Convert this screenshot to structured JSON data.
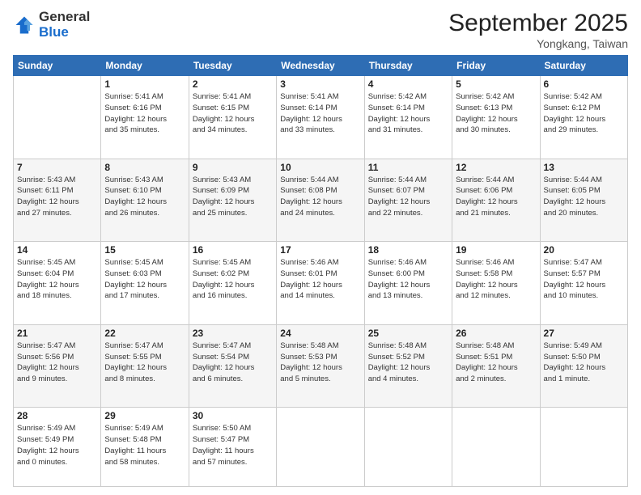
{
  "logo": {
    "line1": "General",
    "line2": "Blue"
  },
  "header": {
    "month": "September 2025",
    "location": "Yongkang, Taiwan"
  },
  "weekdays": [
    "Sunday",
    "Monday",
    "Tuesday",
    "Wednesday",
    "Thursday",
    "Friday",
    "Saturday"
  ],
  "weeks": [
    [
      {
        "day": "",
        "info": ""
      },
      {
        "day": "1",
        "info": "Sunrise: 5:41 AM\nSunset: 6:16 PM\nDaylight: 12 hours\nand 35 minutes."
      },
      {
        "day": "2",
        "info": "Sunrise: 5:41 AM\nSunset: 6:15 PM\nDaylight: 12 hours\nand 34 minutes."
      },
      {
        "day": "3",
        "info": "Sunrise: 5:41 AM\nSunset: 6:14 PM\nDaylight: 12 hours\nand 33 minutes."
      },
      {
        "day": "4",
        "info": "Sunrise: 5:42 AM\nSunset: 6:14 PM\nDaylight: 12 hours\nand 31 minutes."
      },
      {
        "day": "5",
        "info": "Sunrise: 5:42 AM\nSunset: 6:13 PM\nDaylight: 12 hours\nand 30 minutes."
      },
      {
        "day": "6",
        "info": "Sunrise: 5:42 AM\nSunset: 6:12 PM\nDaylight: 12 hours\nand 29 minutes."
      }
    ],
    [
      {
        "day": "7",
        "info": "Sunrise: 5:43 AM\nSunset: 6:11 PM\nDaylight: 12 hours\nand 27 minutes."
      },
      {
        "day": "8",
        "info": "Sunrise: 5:43 AM\nSunset: 6:10 PM\nDaylight: 12 hours\nand 26 minutes."
      },
      {
        "day": "9",
        "info": "Sunrise: 5:43 AM\nSunset: 6:09 PM\nDaylight: 12 hours\nand 25 minutes."
      },
      {
        "day": "10",
        "info": "Sunrise: 5:44 AM\nSunset: 6:08 PM\nDaylight: 12 hours\nand 24 minutes."
      },
      {
        "day": "11",
        "info": "Sunrise: 5:44 AM\nSunset: 6:07 PM\nDaylight: 12 hours\nand 22 minutes."
      },
      {
        "day": "12",
        "info": "Sunrise: 5:44 AM\nSunset: 6:06 PM\nDaylight: 12 hours\nand 21 minutes."
      },
      {
        "day": "13",
        "info": "Sunrise: 5:44 AM\nSunset: 6:05 PM\nDaylight: 12 hours\nand 20 minutes."
      }
    ],
    [
      {
        "day": "14",
        "info": "Sunrise: 5:45 AM\nSunset: 6:04 PM\nDaylight: 12 hours\nand 18 minutes."
      },
      {
        "day": "15",
        "info": "Sunrise: 5:45 AM\nSunset: 6:03 PM\nDaylight: 12 hours\nand 17 minutes."
      },
      {
        "day": "16",
        "info": "Sunrise: 5:45 AM\nSunset: 6:02 PM\nDaylight: 12 hours\nand 16 minutes."
      },
      {
        "day": "17",
        "info": "Sunrise: 5:46 AM\nSunset: 6:01 PM\nDaylight: 12 hours\nand 14 minutes."
      },
      {
        "day": "18",
        "info": "Sunrise: 5:46 AM\nSunset: 6:00 PM\nDaylight: 12 hours\nand 13 minutes."
      },
      {
        "day": "19",
        "info": "Sunrise: 5:46 AM\nSunset: 5:58 PM\nDaylight: 12 hours\nand 12 minutes."
      },
      {
        "day": "20",
        "info": "Sunrise: 5:47 AM\nSunset: 5:57 PM\nDaylight: 12 hours\nand 10 minutes."
      }
    ],
    [
      {
        "day": "21",
        "info": "Sunrise: 5:47 AM\nSunset: 5:56 PM\nDaylight: 12 hours\nand 9 minutes."
      },
      {
        "day": "22",
        "info": "Sunrise: 5:47 AM\nSunset: 5:55 PM\nDaylight: 12 hours\nand 8 minutes."
      },
      {
        "day": "23",
        "info": "Sunrise: 5:47 AM\nSunset: 5:54 PM\nDaylight: 12 hours\nand 6 minutes."
      },
      {
        "day": "24",
        "info": "Sunrise: 5:48 AM\nSunset: 5:53 PM\nDaylight: 12 hours\nand 5 minutes."
      },
      {
        "day": "25",
        "info": "Sunrise: 5:48 AM\nSunset: 5:52 PM\nDaylight: 12 hours\nand 4 minutes."
      },
      {
        "day": "26",
        "info": "Sunrise: 5:48 AM\nSunset: 5:51 PM\nDaylight: 12 hours\nand 2 minutes."
      },
      {
        "day": "27",
        "info": "Sunrise: 5:49 AM\nSunset: 5:50 PM\nDaylight: 12 hours\nand 1 minute."
      }
    ],
    [
      {
        "day": "28",
        "info": "Sunrise: 5:49 AM\nSunset: 5:49 PM\nDaylight: 12 hours\nand 0 minutes."
      },
      {
        "day": "29",
        "info": "Sunrise: 5:49 AM\nSunset: 5:48 PM\nDaylight: 11 hours\nand 58 minutes."
      },
      {
        "day": "30",
        "info": "Sunrise: 5:50 AM\nSunset: 5:47 PM\nDaylight: 11 hours\nand 57 minutes."
      },
      {
        "day": "",
        "info": ""
      },
      {
        "day": "",
        "info": ""
      },
      {
        "day": "",
        "info": ""
      },
      {
        "day": "",
        "info": ""
      }
    ]
  ]
}
